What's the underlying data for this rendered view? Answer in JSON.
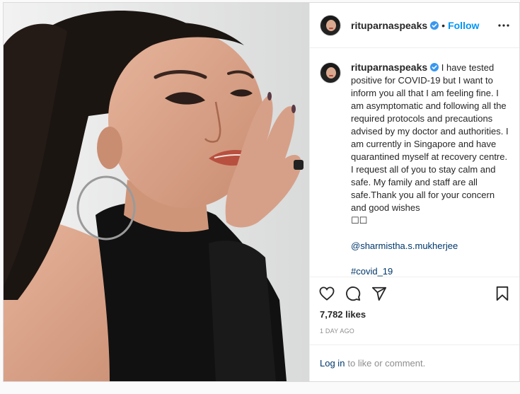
{
  "post": {
    "username": "rituparnaspeaks",
    "follow_label": "Follow",
    "separator": "•",
    "caption": "I have tested positive for COVID-19 but I want to inform you all that I am feeling fine. I am asymptomatic and following all the required protocols and precautions advised by my doctor and authorities. I am currently in Singapore and have quarantined myself at recovery centre. I request all of you to stay calm and safe. My family and staff are all safe.Thank you all for your concern and good wishes",
    "caption_emoji": "☐☐",
    "mention": "@sharmistha.s.mukherjee",
    "hashtag": "#covid_19",
    "age": "1d",
    "likes": "7,782 likes",
    "timestamp": "1 DAY AGO",
    "login_link": "Log in",
    "login_rest": "to like or comment."
  },
  "icons": {
    "verified": "verified-badge-icon",
    "more": "more-options-icon",
    "like": "heart-icon",
    "comment": "comment-bubble-icon",
    "share": "paper-plane-icon",
    "save": "bookmark-icon"
  },
  "colors": {
    "accent": "#0095f6",
    "link": "#00376b",
    "muted": "#8e8e8e"
  }
}
